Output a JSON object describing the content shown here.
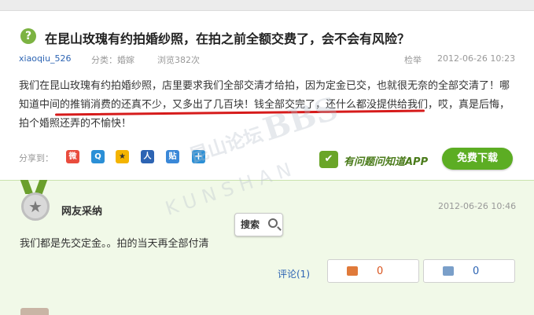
{
  "question": {
    "title": "在昆山玫瑰有约拍婚纱照，在拍之前全额交费了，会不会有风险？",
    "user": "xiaoqiu_526",
    "category": "分类：婚嫁",
    "views": "浏览382次",
    "report": "检举",
    "date": "2012-06-26 10:23",
    "body": "我们在昆山玫瑰有约拍婚纱照，店里要求我们全部交清才给拍，因为定金已交，也就很无奈的全部交清了！哪知道中间的推销消费的还真不少，又多出了几百块！钱全部交完了，还什么都没提供给我们，哎，真是后悔，拍个婚照还弄的不愉快！"
  },
  "share": {
    "label": "分享到：",
    "icons": [
      "weibo-icon",
      "qzone-icon",
      "star-icon",
      "renren-icon",
      "tieba-icon",
      "plus-icon"
    ]
  },
  "promo": {
    "text": "有问题问知道APP",
    "button": "免费下载"
  },
  "answer": {
    "label": "网友采纳",
    "date": "2012-06-26 10:46",
    "body": "我们都是先交定金。。拍的当天再全部付清",
    "comment": "评论(1)",
    "upvotes": "0",
    "downvotes": "0"
  },
  "search_button": "搜索",
  "watermark": {
    "line1": "昆山论坛",
    "line2": "BBS",
    "line3": "KUNSHAN"
  },
  "colors": {
    "accent_green": "#5cad23",
    "link_blue": "#2d64b3",
    "highlight_red": "#d61b1b",
    "answer_bg": "#f1f9e8"
  }
}
